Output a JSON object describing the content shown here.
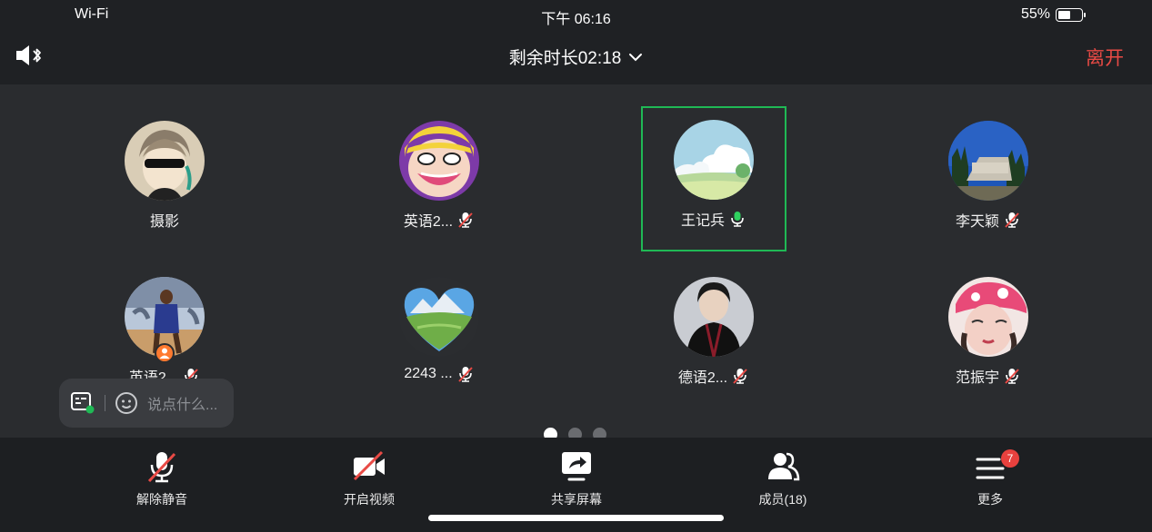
{
  "status_bar": {
    "wifi_label": "Wi-Fi",
    "time": "下午 06:16",
    "battery": "55%",
    "battery_level": 0.55
  },
  "header": {
    "remaining_time": "剩余时长02:18",
    "leave_label": "离开"
  },
  "participants": [
    {
      "name": "摄影",
      "mic": "none"
    },
    {
      "name": "英语2...",
      "mic": "muted"
    },
    {
      "name": "王记兵",
      "mic": "speaking",
      "active": true
    },
    {
      "name": "李天颖",
      "mic": "muted"
    },
    {
      "name": "英语2...",
      "mic": "muted",
      "host": true
    },
    {
      "name": "2243 ...",
      "mic": "muted"
    },
    {
      "name": "德语2...",
      "mic": "muted"
    },
    {
      "name": "范振宇",
      "mic": "muted"
    }
  ],
  "chat": {
    "placeholder": "说点什么..."
  },
  "pager": {
    "pages": 3,
    "current": 1
  },
  "toolbar": {
    "unmute_label": "解除静音",
    "video_label": "开启视频",
    "share_label": "共享屏幕",
    "members_label": "成员(18)",
    "more_label": "更多",
    "more_badge": "7"
  },
  "colors": {
    "accent_green": "#1fb955",
    "leave_red": "#e84a45",
    "badge_red": "#e8413e",
    "host_orange": "#ff7a2f"
  }
}
